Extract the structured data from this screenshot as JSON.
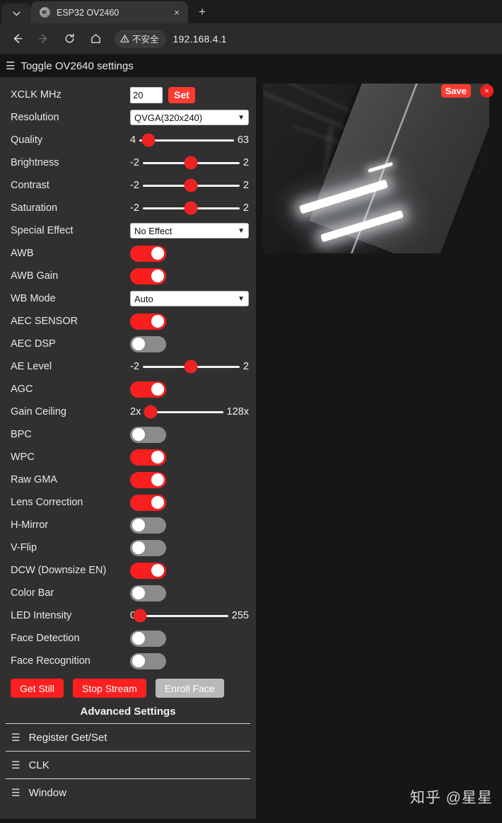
{
  "browser": {
    "tab": {
      "title": "ESP32 OV2460",
      "favicon": "globe-icon",
      "close": "×"
    },
    "new_tab": "+",
    "tab_list_chevron": "⌄",
    "toolbar": {
      "back": "←",
      "forward": "→",
      "reload": "↻",
      "home": "⌂",
      "security_label": "不安全",
      "url": "192.168.4.1"
    }
  },
  "page": {
    "header": {
      "menu_icon": "☰",
      "title": "Toggle OV2640 settings"
    },
    "accent_red": "#fa1f1f",
    "panel_bg": "#303030"
  },
  "settings": {
    "xclk": {
      "label": "XCLK MHz",
      "value": "20",
      "set_label": "Set"
    },
    "resolution": {
      "label": "Resolution",
      "value": "QVGA(320x240)"
    },
    "sliders": [
      {
        "label": "Quality",
        "min": "4",
        "max": "63",
        "value": 10,
        "pct": 10
      },
      {
        "label": "Brightness",
        "min": "-2",
        "max": "2",
        "value": 0,
        "pct": 50
      },
      {
        "label": "Contrast",
        "min": "-2",
        "max": "2",
        "value": 0,
        "pct": 50
      },
      {
        "label": "Saturation",
        "min": "-2",
        "max": "2",
        "value": 0,
        "pct": 50
      }
    ],
    "special_effect": {
      "label": "Special Effect",
      "value": "No Effect"
    },
    "awb": {
      "label": "AWB",
      "state": "on"
    },
    "awb_gain": {
      "label": "AWB Gain",
      "state": "on"
    },
    "wb_mode": {
      "label": "WB Mode",
      "value": "Auto"
    },
    "aec_sensor": {
      "label": "AEC SENSOR",
      "state": "on"
    },
    "aec_dsp": {
      "label": "AEC DSP",
      "state": "off"
    },
    "ae_level": {
      "label": "AE Level",
      "min": "-2",
      "max": "2",
      "value": 0,
      "pct": 50
    },
    "agc": {
      "label": "AGC",
      "state": "on"
    },
    "gain_ceiling": {
      "label": "Gain Ceiling",
      "min": "2x",
      "max": "128x",
      "value": "2x",
      "pct": 8
    },
    "bpc": {
      "label": "BPC",
      "state": "off"
    },
    "wpc": {
      "label": "WPC",
      "state": "on"
    },
    "raw_gma": {
      "label": "Raw GMA",
      "state": "on"
    },
    "lens_correction": {
      "label": "Lens Correction",
      "state": "on"
    },
    "h_mirror": {
      "label": "H-Mirror",
      "state": "off"
    },
    "v_flip": {
      "label": "V-Flip",
      "state": "off"
    },
    "dcw": {
      "label": "DCW (Downsize EN)",
      "state": "on"
    },
    "color_bar": {
      "label": "Color Bar",
      "state": "off"
    },
    "led_intensity": {
      "label": "LED Intensity",
      "min": "0",
      "max": "255",
      "value": "0",
      "pct": 1
    },
    "face_detection": {
      "label": "Face Detection",
      "state": "off"
    },
    "face_recognition": {
      "label": "Face Recognition",
      "state": "off"
    },
    "buttons": {
      "get_still": "Get Still",
      "stop_stream": "Stop Stream",
      "enroll_face": "Enroll Face"
    },
    "advanced_title": "Advanced Settings",
    "advanced_sections": [
      {
        "icon": "☰",
        "label": "Register Get/Set"
      },
      {
        "icon": "☰",
        "label": "CLK"
      },
      {
        "icon": "☰",
        "label": "Window"
      }
    ]
  },
  "stream": {
    "save_label": "Save",
    "close_label": "×",
    "alt": "Dark ceiling view with two bright fluorescent light tubes"
  },
  "watermark": "知乎 @星星"
}
